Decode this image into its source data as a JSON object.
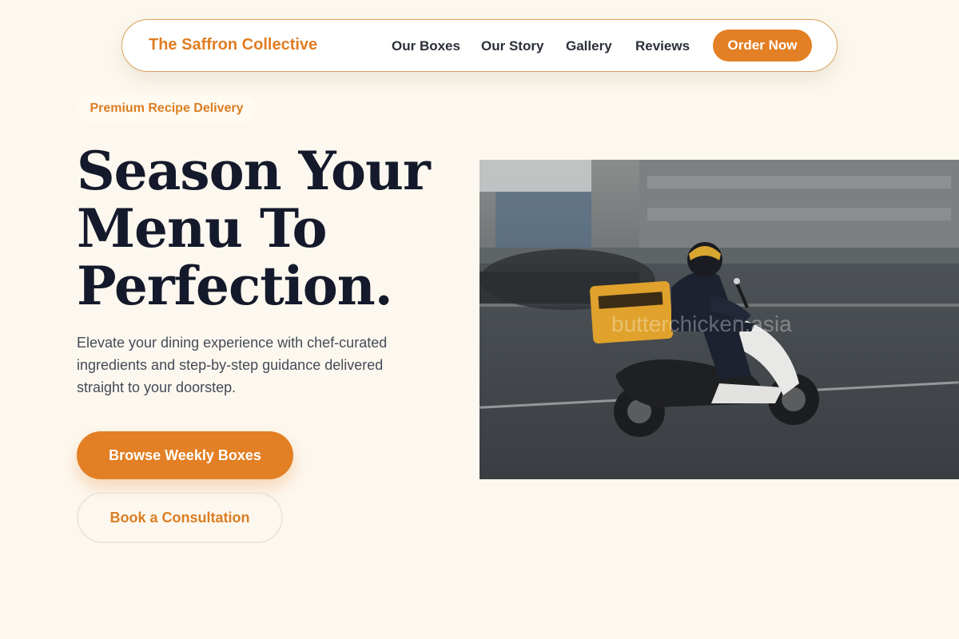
{
  "nav": {
    "brand": "The Saffron Collective",
    "links": [
      "Our Boxes",
      "Our Story",
      "Gallery",
      "Reviews"
    ],
    "cta": "Order Now"
  },
  "hero": {
    "badge": "Premium Recipe Delivery",
    "headline_lines": [
      "Season Your",
      "Menu To",
      "Perfection."
    ],
    "lede": "Elevate your dining experience with chef-curated ingredients and step-by-step guidance delivered straight to your doorstep.",
    "primary_cta": "Browse Weekly Boxes",
    "secondary_cta": "Book a Consultation",
    "image": {
      "watermark": "butterchicken.asia"
    }
  },
  "colors": {
    "accent": "#e37f24",
    "background": "#fdf8ef",
    "heading": "#141a2b"
  }
}
